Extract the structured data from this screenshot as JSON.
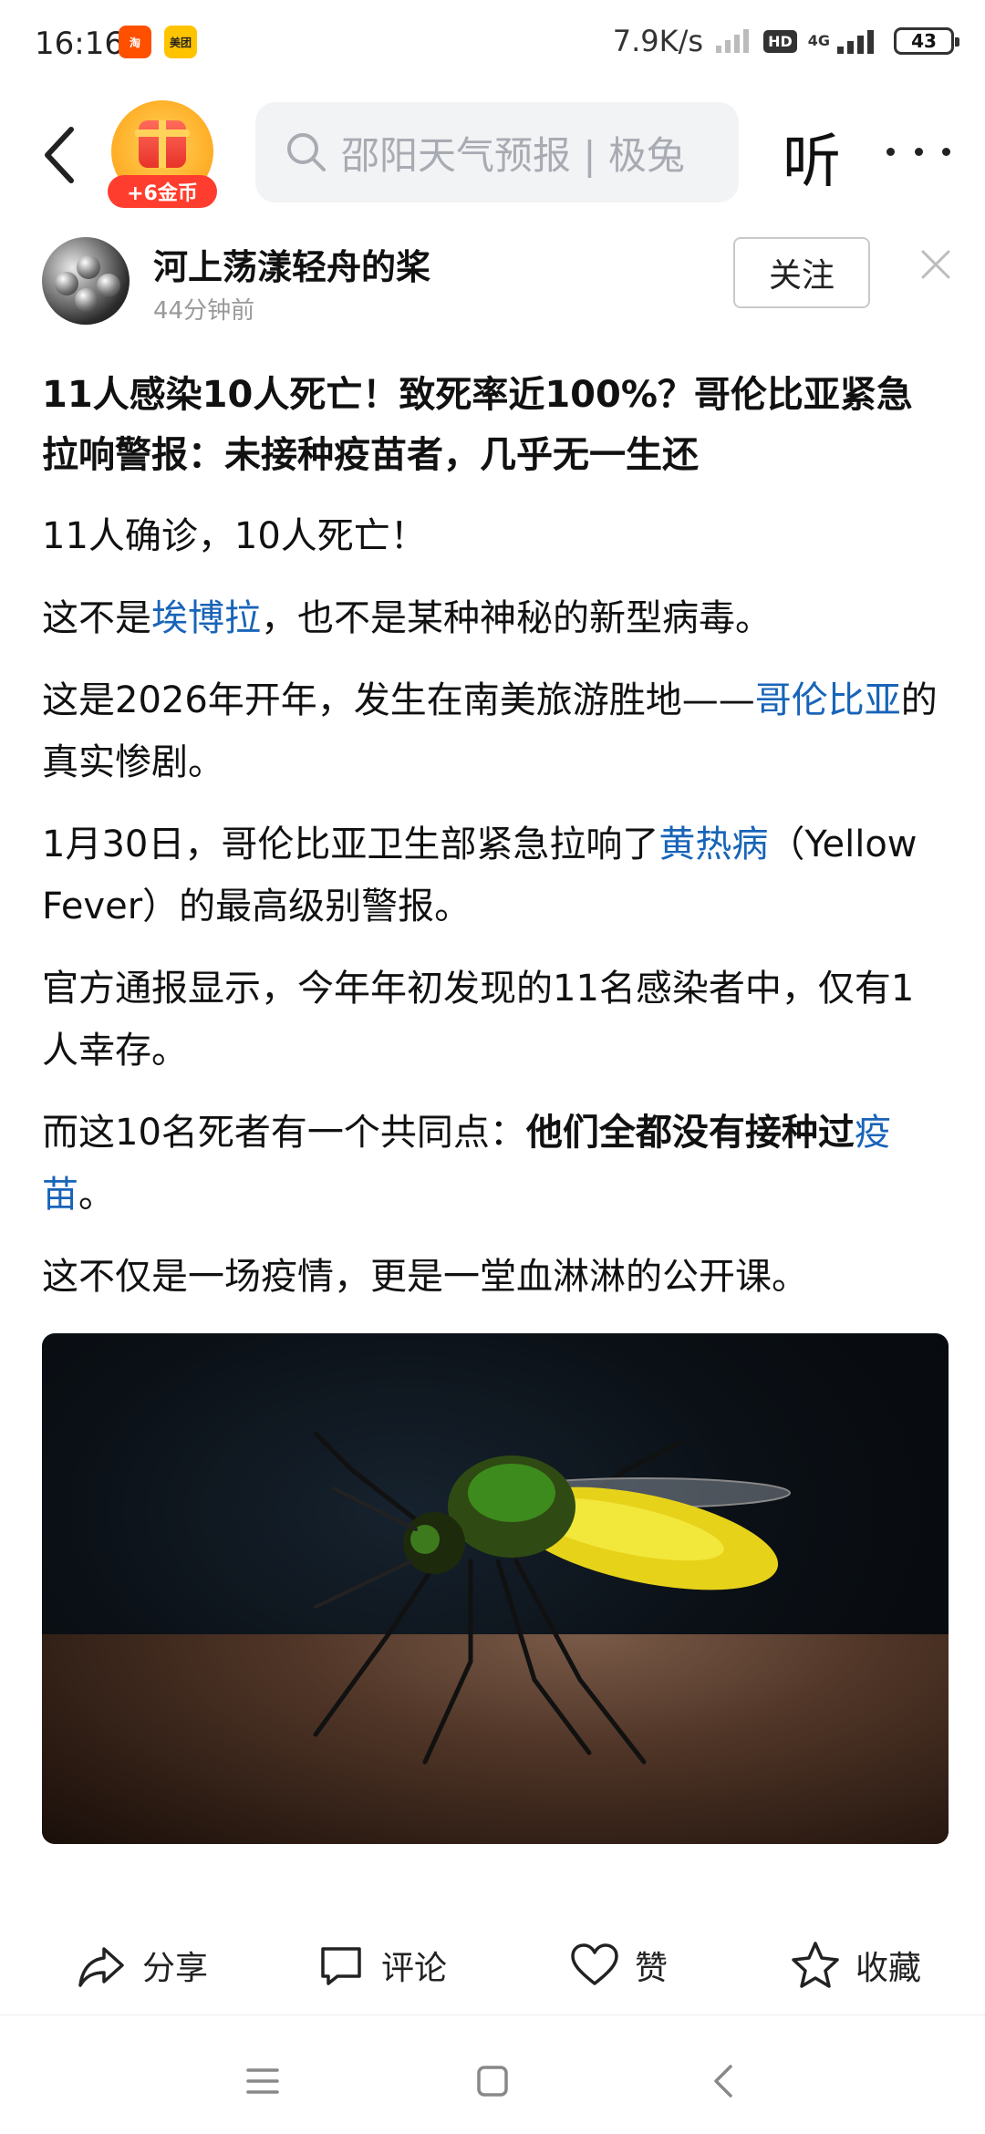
{
  "status_bar": {
    "time": "16:16",
    "apps": [
      "taobao-icon",
      "meituan-icon"
    ],
    "taobao_text": "淘",
    "meituan_text": "美团",
    "net_speed": "7.9K/s",
    "hd": "HD",
    "network": "4G",
    "battery": "43"
  },
  "top_nav": {
    "coin_label": "+6金币",
    "search_placeholder": "邵阳天气预报 | 极兔",
    "listen_label": "听"
  },
  "author": {
    "name": "河上荡漾轻舟的桨",
    "time": "44分钟前",
    "follow_label": "关注"
  },
  "article": {
    "headline": "11人感染10人死亡！致死率近100%？哥伦比亚紧急拉响警报：未接种疫苗者，几乎无一生还",
    "p1": "11人确诊，10人死亡！",
    "p2": {
      "before": "这不是",
      "link": "埃博拉",
      "after": "，也不是某种神秘的新型病毒。"
    },
    "p3": {
      "before": "这是2026年开年，发生在南美旅游胜地——",
      "link": "哥伦比亚",
      "after": "的真实惨剧。"
    },
    "p4": {
      "before": "1月30日，哥伦比亚卫生部紧急拉响了",
      "link": "黄热病",
      "after": "（Yellow Fever）的最高级别警报。"
    },
    "p5": "官方通报显示，今年年初发现的11名感染者中，仅有1人幸存。",
    "p6": {
      "before": "而这10名死者有一个共同点：",
      "bold": "他们全都没有接种过",
      "link": "疫苗",
      "after": "。"
    },
    "p7": "这不仅是一场疫情，更是一堂血淋淋的公开课。"
  },
  "actions": {
    "share": "分享",
    "comment": "评论",
    "like": "赞",
    "favorite": "收藏"
  },
  "colors": {
    "link": "#1864b8",
    "coin_badge": "#ff3d2e",
    "search_bg": "#f2f3f5"
  }
}
